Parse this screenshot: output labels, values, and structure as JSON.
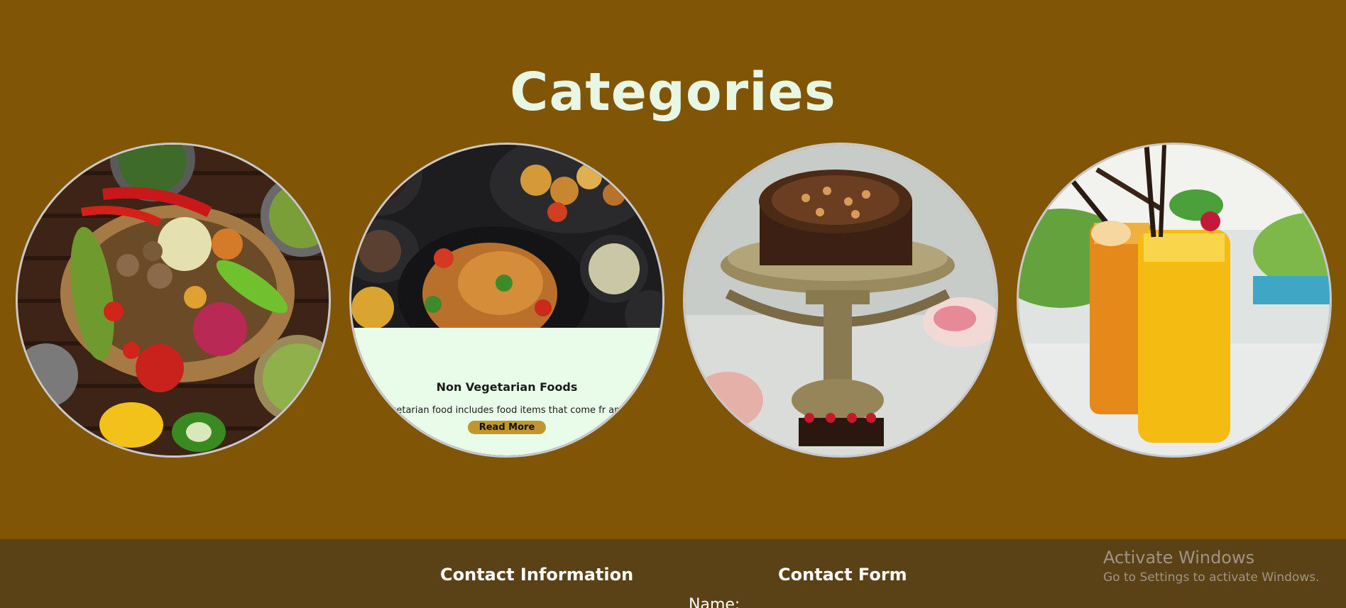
{
  "section": {
    "title": "Categories"
  },
  "categories": [
    {
      "image": "vegetables-basket-image"
    },
    {
      "image": "roast-chicken-image",
      "title": "Non Vegetarian Foods",
      "text": "Non-vegetarian food includes food items that come from animals.",
      "visible_text": "n-vegetarian food includes food items that come fr animals.",
      "button": "Read More"
    },
    {
      "image": "chocolate-cake-image"
    },
    {
      "image": "juice-glasses-image"
    }
  ],
  "footer": {
    "contact_info_title": "Contact Information",
    "contact_form_title": "Contact Form",
    "name_label": "Name:"
  },
  "watermark": {
    "title": "Activate Windows",
    "subtitle": "Go to Settings to activate Windows."
  },
  "colors": {
    "background": "#805506",
    "heading": "#e8f7e4",
    "card_overlay": "#e9fbe9",
    "button": "#c1962f",
    "footer": "#5a4116"
  }
}
